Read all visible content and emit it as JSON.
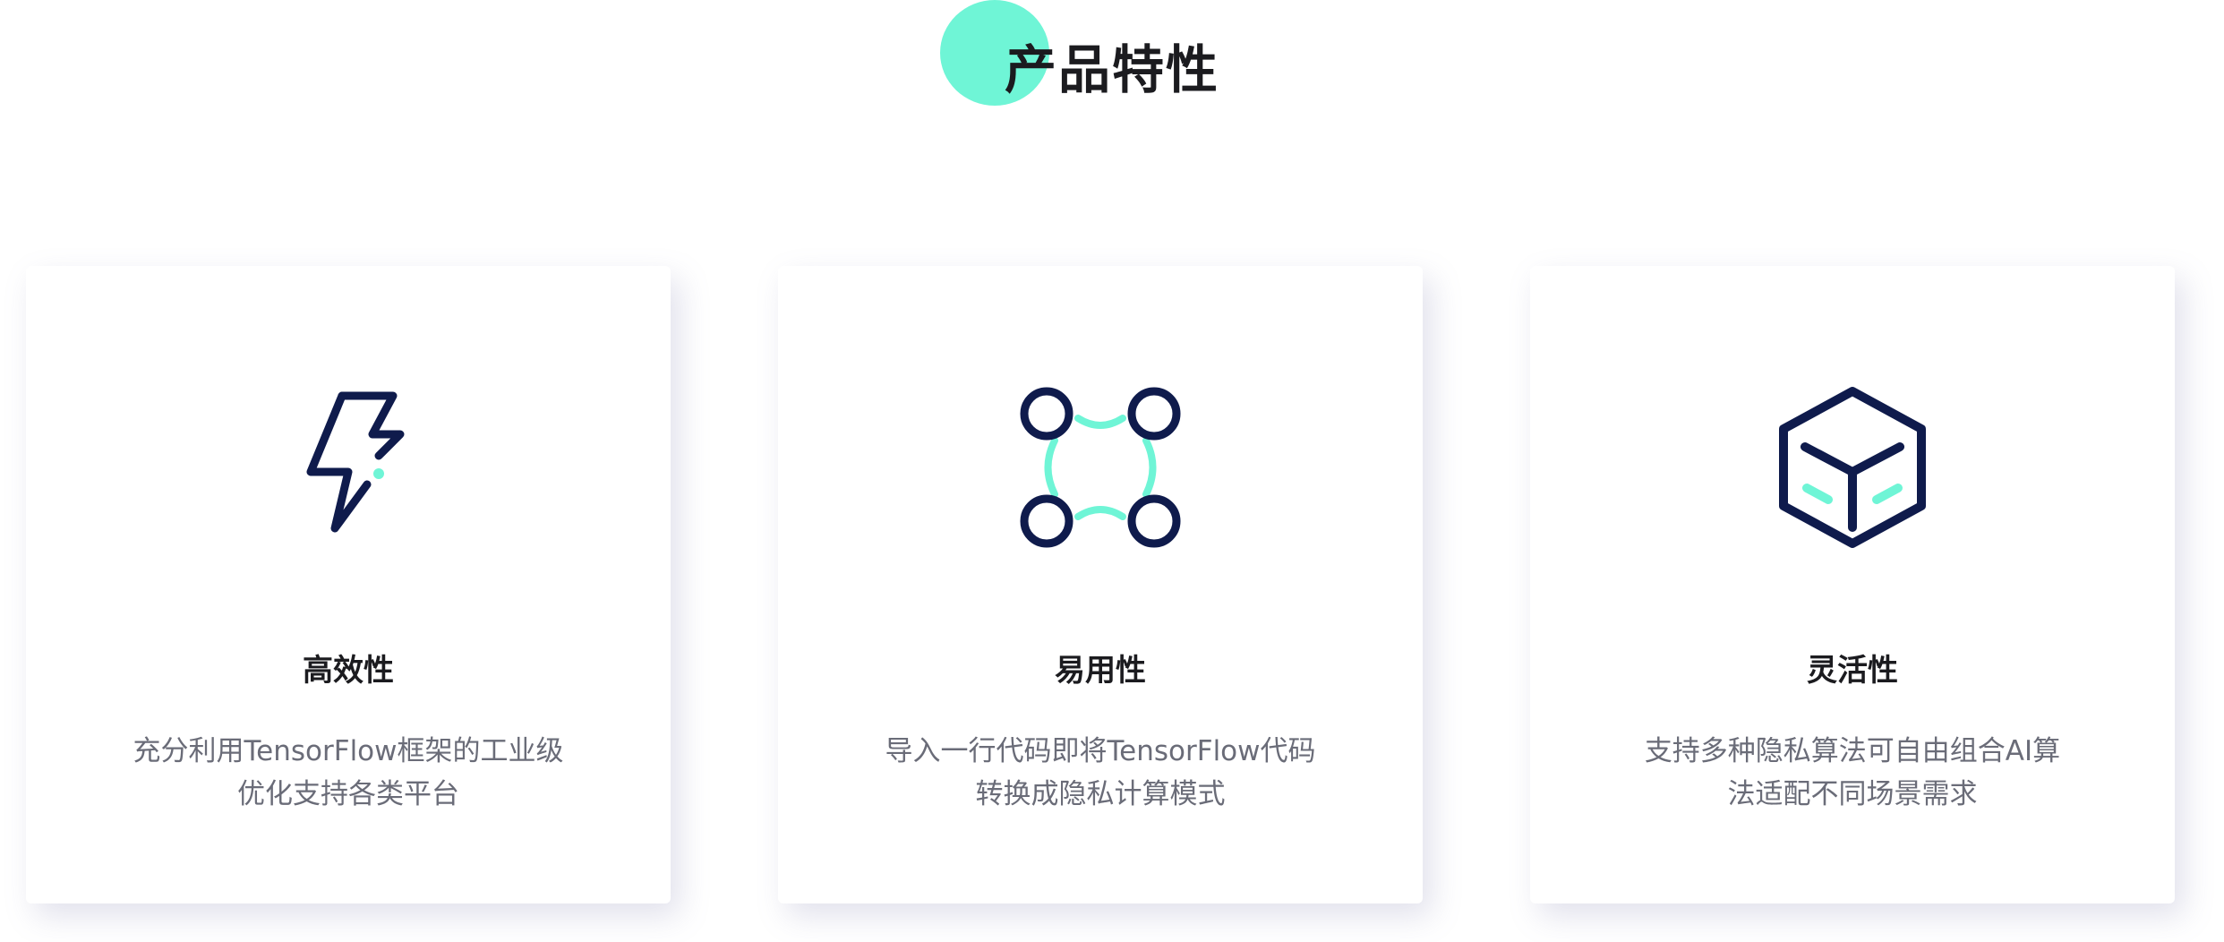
{
  "section": {
    "title": "产品特性"
  },
  "colors": {
    "accent": "#6ff5d6",
    "icon_navy": "#0f1b4c",
    "title_text": "#1b1b1f",
    "body_text": "#6a6c78"
  },
  "features": [
    {
      "icon": "lightning-bolt-icon",
      "title": "高效性",
      "desc_line1": "充分利用TensorFlow框架的工业级",
      "desc_line2": "优化支持各类平台"
    },
    {
      "icon": "network-nodes-icon",
      "title": "易用性",
      "desc_line1": "导入一行代码即将TensorFlow代码",
      "desc_line2": "转换成隐私计算模式"
    },
    {
      "icon": "cube-icon",
      "title": "灵活性",
      "desc_line1": "支持多种隐私算法可自由组合AI算",
      "desc_line2": "法适配不同场景需求"
    }
  ]
}
